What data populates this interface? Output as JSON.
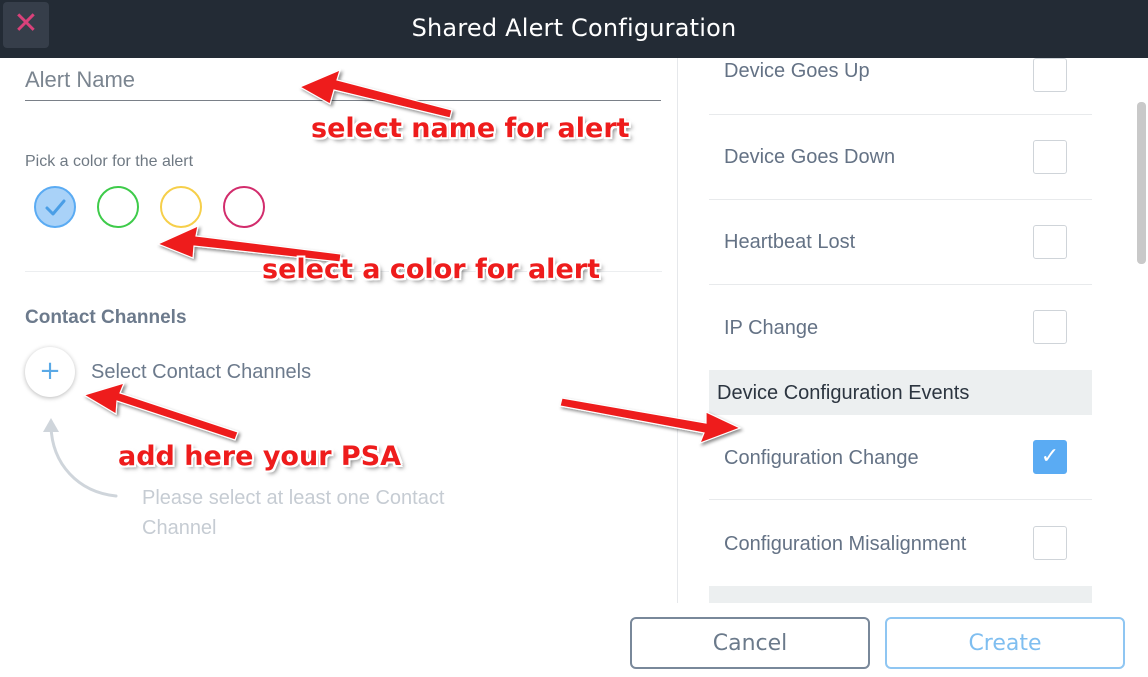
{
  "window": {
    "title": "Shared Alert Configuration",
    "close_symbol": "✕"
  },
  "form": {
    "alert_name_placeholder": "Alert Name",
    "alert_name_value": "",
    "color_label": "Pick a color for the alert",
    "colors": [
      {
        "name": "blue",
        "hex": "#5aabf3",
        "selected": true,
        "check": "✓"
      },
      {
        "name": "green",
        "hex": "#3ecb4a",
        "selected": false
      },
      {
        "name": "yellow",
        "hex": "#f6cf4a",
        "selected": false
      },
      {
        "name": "pink",
        "hex": "#d22c6c",
        "selected": false
      }
    ],
    "contact_channels_title": "Contact Channels",
    "add_symbol": "+",
    "select_contact_label": "Select Contact Channels",
    "contact_hint": "Please select at least one Contact Channel"
  },
  "events": {
    "rows_top": [
      {
        "label": "Device Goes Up",
        "checked": false
      },
      {
        "label": "Device Goes Down",
        "checked": false
      },
      {
        "label": "Heartbeat Lost",
        "checked": false
      },
      {
        "label": "IP Change",
        "checked": false
      }
    ],
    "group": "Device Configuration Events",
    "rows_group": [
      {
        "label": "Configuration Change",
        "checked": true,
        "check": "✓"
      },
      {
        "label": "Configuration Misalignment",
        "checked": false
      }
    ]
  },
  "footer": {
    "cancel_label": "Cancel",
    "create_label": "Create"
  },
  "annotations": {
    "name": "select name for alert",
    "color": "select a color for alert",
    "psa": "add here your PSA",
    "color_hex": "#ee1c1c"
  }
}
